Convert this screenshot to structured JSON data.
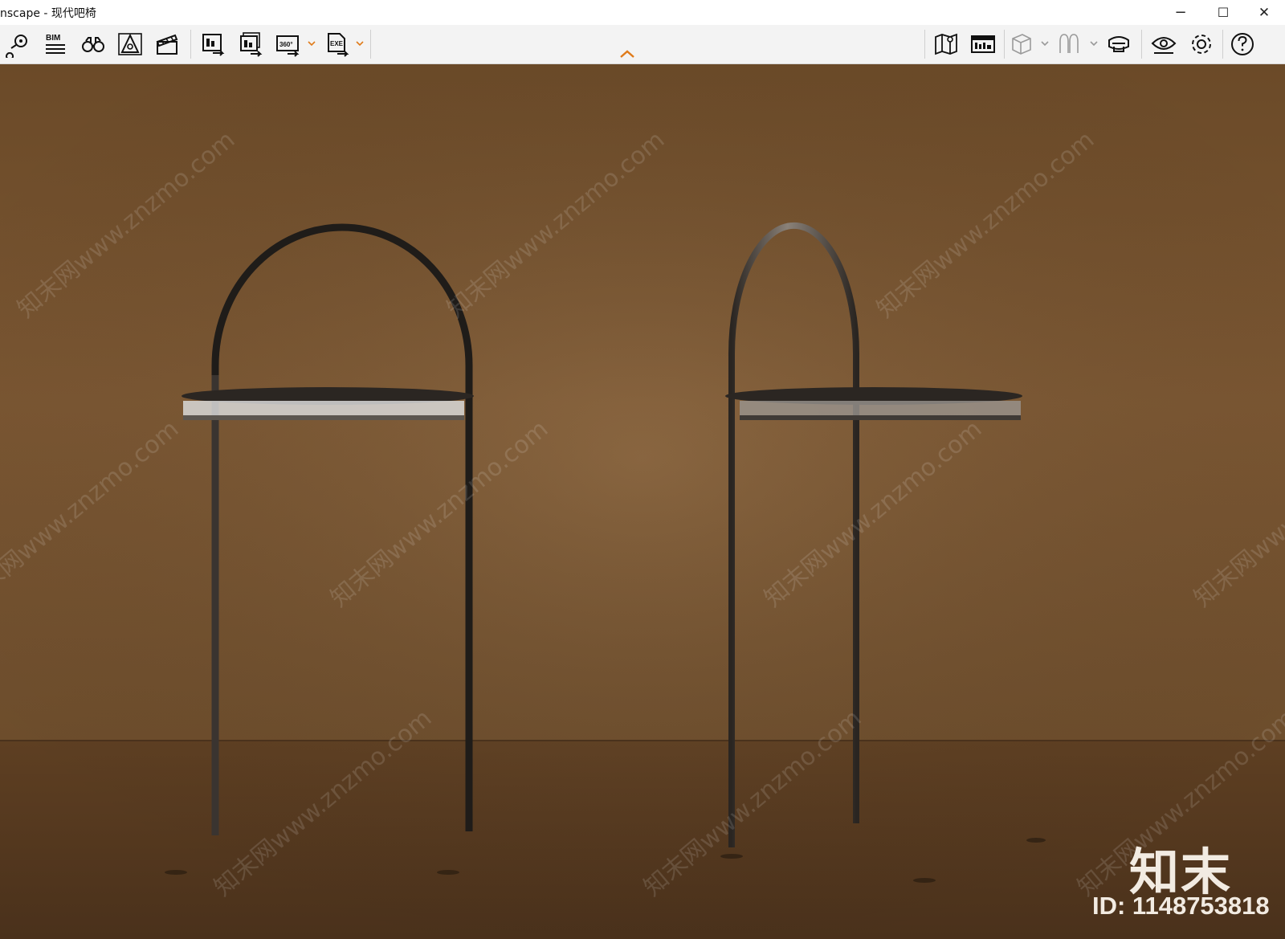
{
  "window": {
    "title": "nscape - 现代吧椅",
    "controls": {
      "minimize": "−",
      "maximize": "☐",
      "close": "✕"
    }
  },
  "toolbar": {
    "bim_label": "BIM",
    "pano_label": "360°",
    "exe_label": "EXE",
    "left_icons": [
      "map-pin-icon",
      "bim-list-icon",
      "binoculars-icon",
      "vr-cone-icon",
      "clapperboard-icon",
      "export-image-icon",
      "export-batch-icon",
      "export-360-icon",
      "export-exe-icon"
    ],
    "right_icons": [
      "map-icon",
      "render-panel-icon",
      "cube-icon",
      "mannequin-icon",
      "vr-headset-icon",
      "visibility-eye-icon",
      "settings-gear-icon",
      "help-icon"
    ],
    "accent_color": "#e07b1a"
  },
  "viewport": {
    "watermark_text": "知末网www.znzmo.com",
    "brand": "知末",
    "asset_id": "ID: 1148753818",
    "wall_color": "#74512e",
    "floor_color": "#5a3c20"
  }
}
